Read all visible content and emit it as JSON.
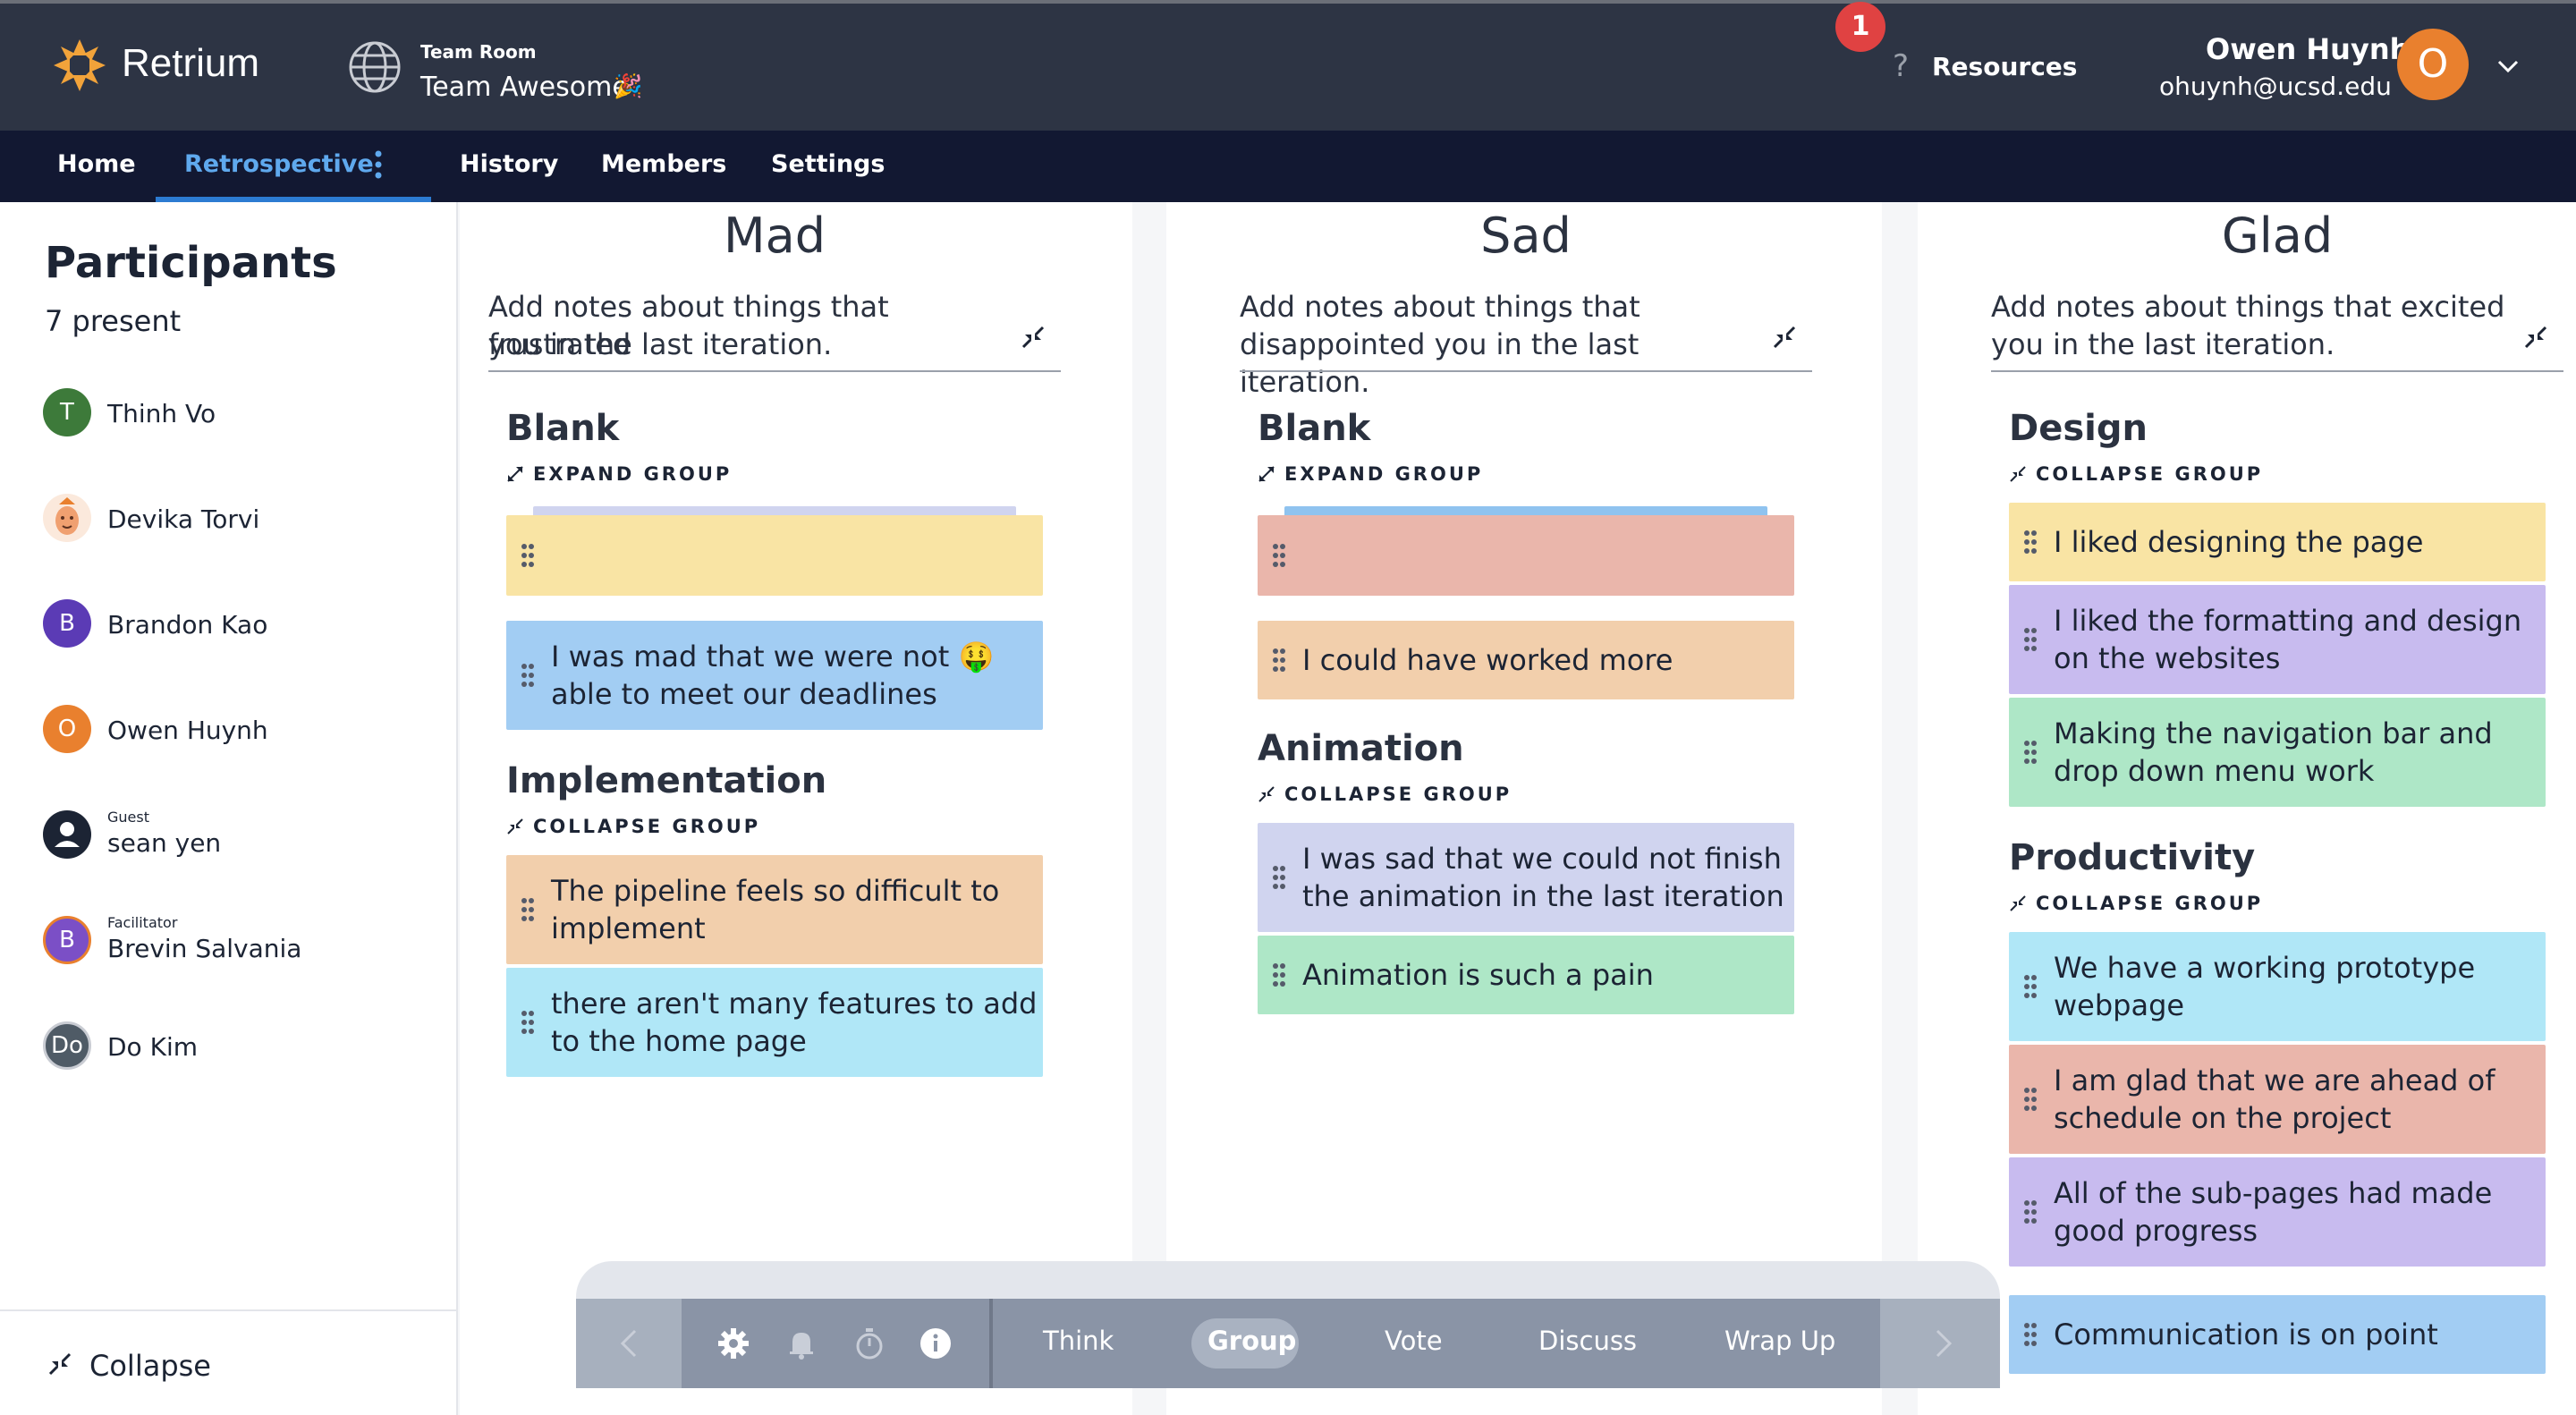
{
  "header": {
    "brand": "Retrium",
    "team_room_label": "Team Room",
    "team_name": "Team Awesome",
    "team_emoji": "🎉",
    "notification_count": "1",
    "help_glyph": "?",
    "resources_label": "Resources",
    "user_name": "Owen Huynh",
    "user_email": "ohuynh@ucsd.edu",
    "user_initial": "O"
  },
  "nav": {
    "home": "Home",
    "retrospective": "Retrospective",
    "history": "History",
    "members": "Members",
    "settings": "Settings"
  },
  "sidebar": {
    "title": "Participants",
    "count": "7 present",
    "collapse_label": "Collapse",
    "participants": [
      {
        "name": "Thinh Vo",
        "initial": "T",
        "color": "#3d7a3a",
        "role": ""
      },
      {
        "name": "Devika Torvi",
        "initial": "",
        "color": "#f6cfae",
        "role": ""
      },
      {
        "name": "Brandon Kao",
        "initial": "B",
        "color": "#5b3bb5",
        "role": ""
      },
      {
        "name": "Owen Huynh",
        "initial": "O",
        "color": "#e9802e",
        "role": ""
      },
      {
        "name": "sean yen",
        "initial": "",
        "color": "#1c2434",
        "role": "Guest"
      },
      {
        "name": "Brevin Salvania",
        "initial": "B",
        "color": "#7b4fc6",
        "role": "Facilitator"
      },
      {
        "name": "Do Kim",
        "initial": "Do",
        "color": "#4f5b66",
        "role": ""
      }
    ]
  },
  "columns": [
    {
      "title": "Mad",
      "description": [
        "Add notes about things that frustrated",
        "you in the last iteration."
      ],
      "groups": [
        {
          "title": "Blank",
          "action": "EXPAND GROUP",
          "cards": [
            "",
            "I was mad that we were not 🤑",
            "able to meet our deadlines"
          ]
        },
        {
          "title": "Implementation",
          "action": "COLLAPSE GROUP",
          "cards": [
            "The pipeline feels so difficult to",
            "implement",
            "there aren't many features to add",
            "to the home page"
          ]
        }
      ]
    },
    {
      "title": "Sad",
      "description": [
        "Add notes about things that",
        "disappointed you in the last iteration."
      ],
      "groups": [
        {
          "title": "Blank",
          "action": "EXPAND GROUP",
          "cards": [
            "",
            "I could have worked more"
          ]
        },
        {
          "title": "Animation",
          "action": "COLLAPSE GROUP",
          "cards": [
            "I was sad that we could not finish",
            "the animation in the last iteration",
            "Animation is such a pain"
          ]
        }
      ]
    },
    {
      "title": "Glad",
      "description": [
        "Add notes about things that excited",
        "you in the last iteration."
      ],
      "groups": [
        {
          "title": "Design",
          "action": "COLLAPSE GROUP",
          "cards": [
            "I liked designing the page",
            "I liked the formatting and design",
            "on the websites",
            "Making the navigation bar and",
            "drop down menu work"
          ]
        },
        {
          "title": "Productivity",
          "action": "COLLAPSE GROUP",
          "cards": [
            "We have a working prototype",
            "webpage",
            "I am glad that we are ahead of",
            "schedule on the project",
            "All of the sub-pages had made",
            "good progress"
          ]
        },
        {
          "title": "",
          "action": "",
          "cards": [
            "Communication is on point"
          ]
        }
      ]
    }
  ],
  "toolbar": {
    "steps": [
      "Think",
      "Group",
      "Vote",
      "Discuss",
      "Wrap Up"
    ],
    "active_step": "Group",
    "icons": [
      "chevron-left-icon",
      "gear-icon",
      "bell-icon",
      "stopwatch-icon",
      "info-icon",
      "chevron-right-icon"
    ]
  },
  "colors": {
    "header_bg": "#2d3444",
    "nav_bg": "#121832",
    "accent": "#5fa9ee",
    "note_yellow": "#f9e4a4",
    "note_blue": "#a2cdf3",
    "note_peach": "#f2cfac",
    "note_cyan": "#b0e7f7",
    "note_salmon": "#eab6ab",
    "note_lavender": "#d0d4ef",
    "note_green": "#aee7c7",
    "note_purple": "#c8bbef"
  }
}
